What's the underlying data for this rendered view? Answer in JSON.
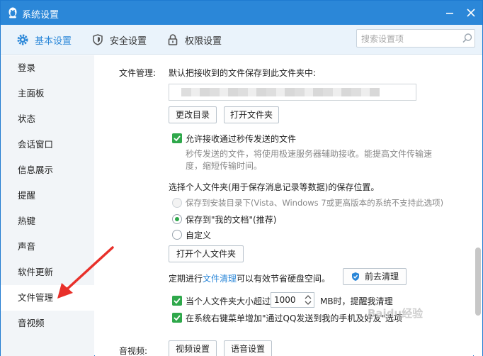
{
  "window": {
    "title": "系统设置"
  },
  "toolbar": {
    "tabs": [
      {
        "label": "基本设置",
        "icon": "gear-icon"
      },
      {
        "label": "安全设置",
        "icon": "shield-icon"
      },
      {
        "label": "权限设置",
        "icon": "lock-icon"
      }
    ],
    "search_placeholder": "搜索设置项"
  },
  "sidebar": {
    "items": [
      {
        "label": "登录"
      },
      {
        "label": "主面板"
      },
      {
        "label": "状态"
      },
      {
        "label": "会话窗口"
      },
      {
        "label": "信息展示"
      },
      {
        "label": "提醒"
      },
      {
        "label": "热键"
      },
      {
        "label": "声音"
      },
      {
        "label": "软件更新"
      },
      {
        "label": "文件管理"
      },
      {
        "label": "音视频"
      }
    ],
    "active_item": "文件管理"
  },
  "file_mgmt": {
    "section_label": "文件管理:",
    "save_desc": "默认把接收到的文件保存到此文件夹中:",
    "change_dir_btn": "更改目录",
    "open_folder_btn": "打开文件夹",
    "allow_flash_label": "允许接收通过秒传发送的文件",
    "flash_desc_1": "秒传发送的文件，将使用极速服务器辅助接收。能提高文件传输速",
    "flash_desc_2": "度，缩短传输时间。",
    "personal_folder_title": "选择个人文件夹(用于保存消息记录等数据)的保存位置。",
    "opt_install_dir": "保存到安装目录下(Vista、Windows 7或更高版本的系统不支持此选项)",
    "opt_my_docs": "保存到\"我的文档\"(推荐)",
    "opt_custom": "自定义",
    "open_personal_btn": "打开个人文件夹",
    "cleanup_prefix": "定期进行",
    "cleanup_link": "文件清理",
    "cleanup_suffix": "可以有效节省硬盘空间。",
    "go_clean_btn": "前去清理",
    "size_limit_label": "当个人文件夹大小超过",
    "size_limit_value": "1000",
    "size_limit_unit": "MB时，提醒我清理",
    "context_menu_label": "在系统右键菜单增加\"通过QQ发送到我的手机及好友\"选项"
  },
  "av": {
    "section_label": "音视频:",
    "video_btn": "视频设置",
    "audio_btn": "语音设置"
  },
  "watermark": "Baidu经验",
  "colors": {
    "accent": "#2b87d8",
    "check": "#2fa84b",
    "arrow": "#e8302a"
  }
}
